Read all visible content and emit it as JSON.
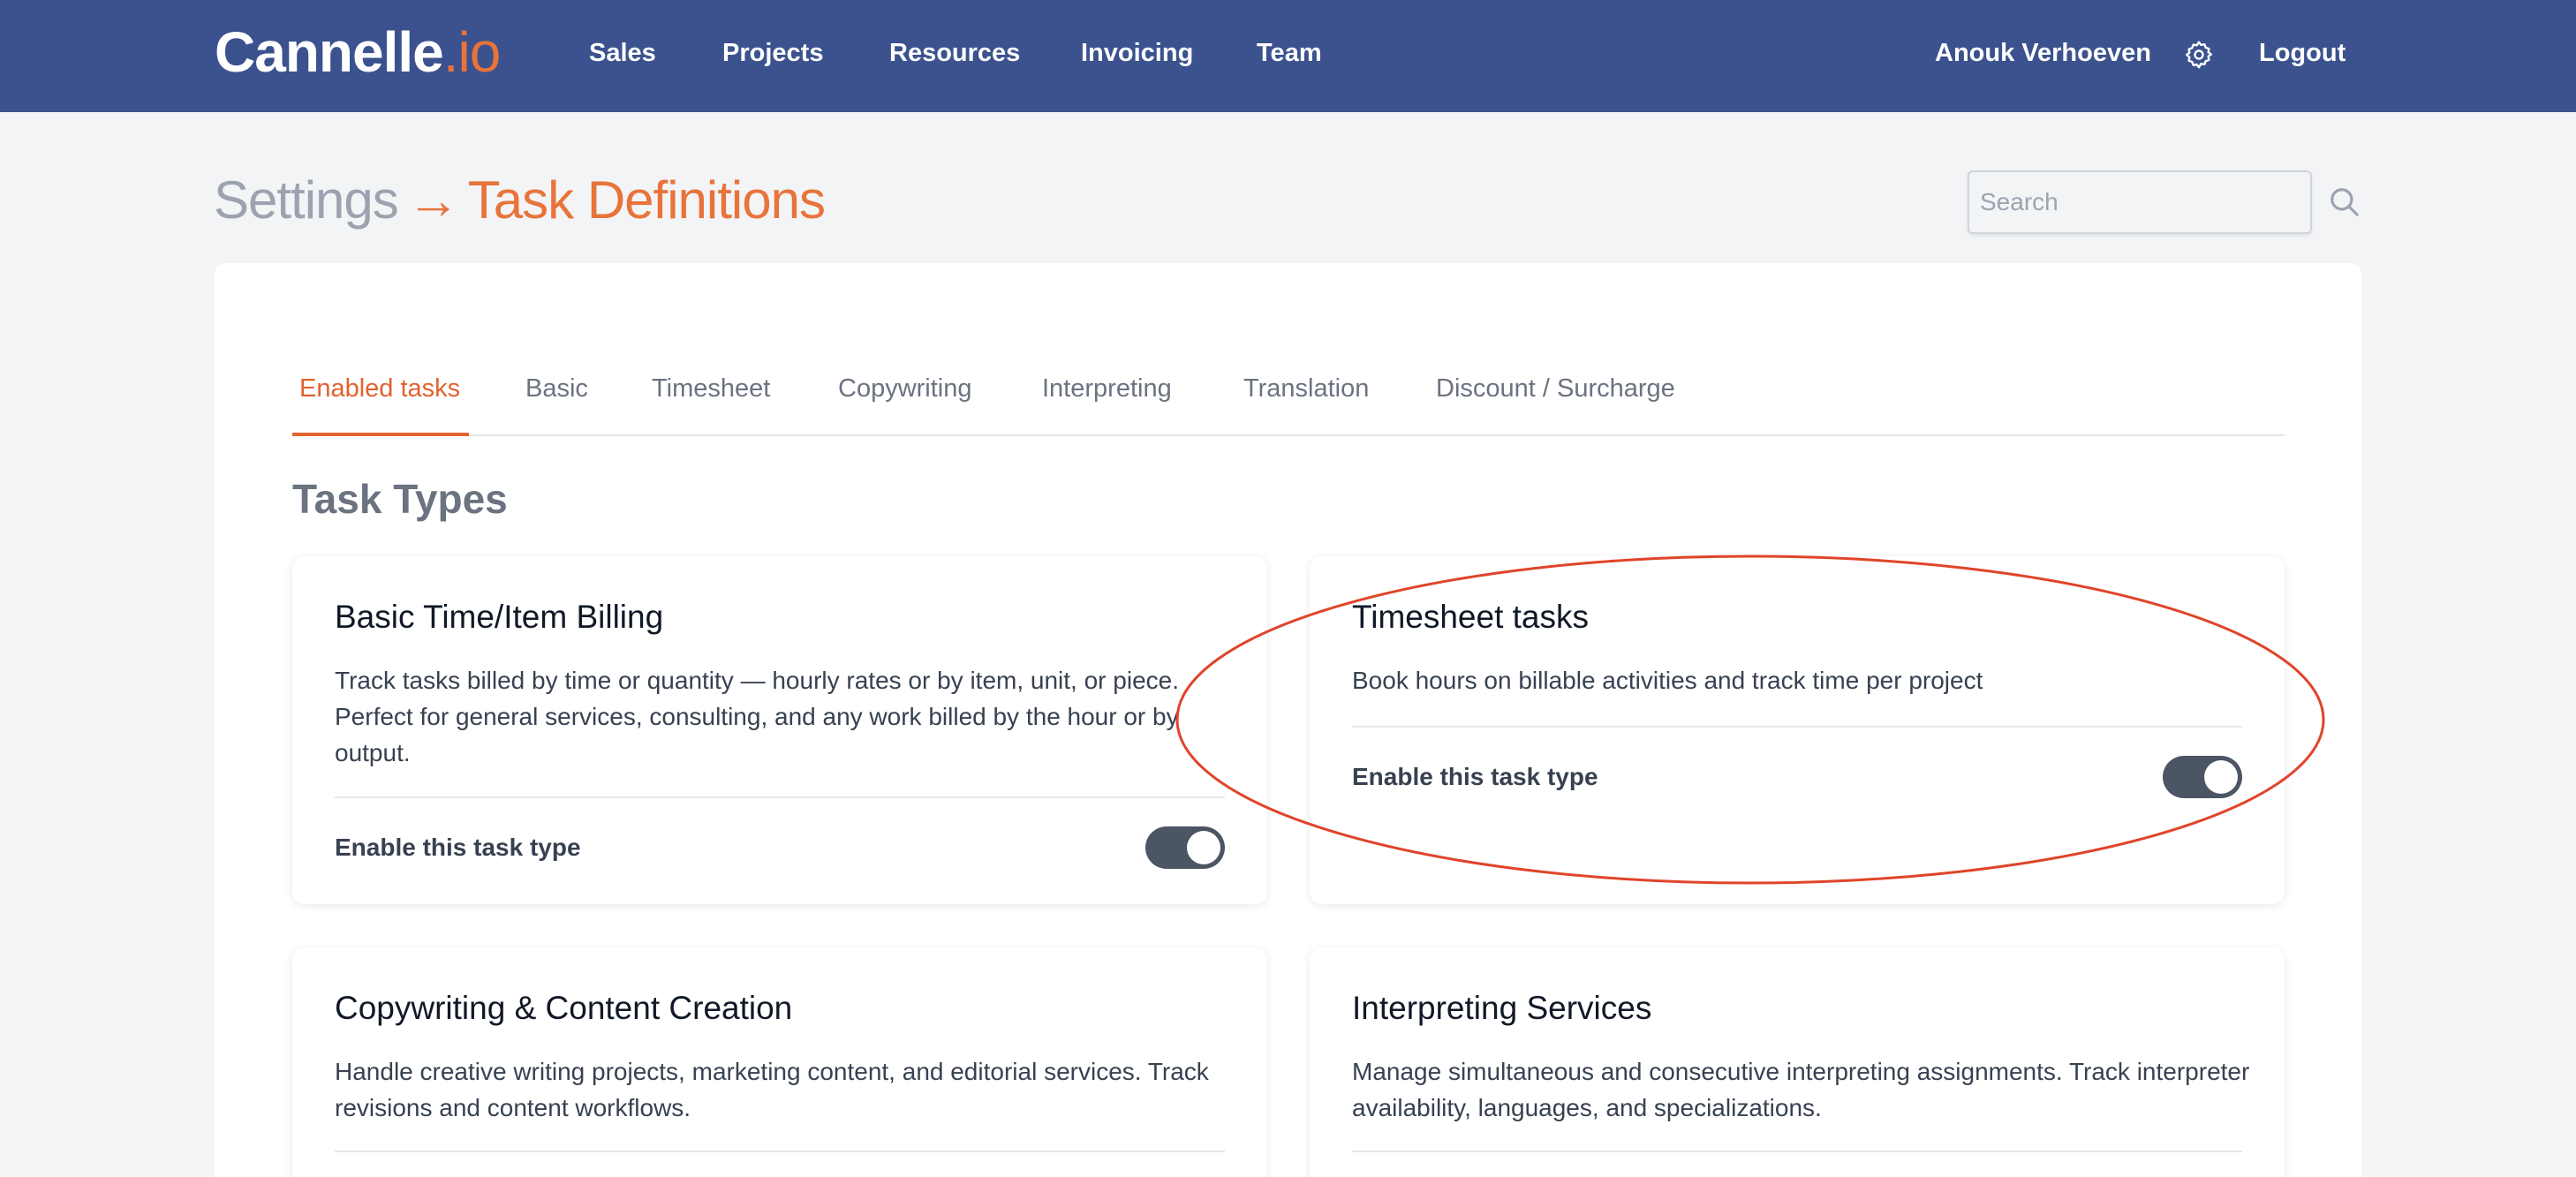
{
  "app": {
    "logo_main": "Cannelle",
    "logo_accent": ".io"
  },
  "nav": {
    "items": [
      "Sales",
      "Projects",
      "Resources",
      "Invoicing",
      "Team"
    ],
    "user_name": "Anouk Verhoeven",
    "settings_icon": "gear-icon",
    "logout_label": "Logout"
  },
  "header": {
    "breadcrumb_parent": "Settings",
    "breadcrumb_separator": "→",
    "breadcrumb_current": "Task Definitions"
  },
  "search": {
    "placeholder": "Search",
    "value": "",
    "icon": "search-icon"
  },
  "tabs": {
    "items": [
      "Enabled tasks",
      "Basic",
      "Timesheet",
      "Copywriting",
      "Interpreting",
      "Translation",
      "Discount / Surcharge"
    ],
    "active": "Enabled tasks"
  },
  "section": {
    "title": "Task Types"
  },
  "task_cards": [
    {
      "title": "Basic Time/Item Billing",
      "description": "Track tasks billed by time or quantity — hourly rates or by item, unit, or piece. Perfect for general services, consulting, and any work billed by the hour or by output.",
      "enable_label": "Enable this task type",
      "enabled": true
    },
    {
      "title": "Timesheet tasks",
      "description": "Book hours on billable activities and track time per project",
      "enable_label": "Enable this task type",
      "enabled": true
    },
    {
      "title": "Copywriting & Content Creation",
      "description": "Handle creative writing projects, marketing content, and editorial services. Track revisions and content workflows."
    },
    {
      "title": "Interpreting Services",
      "description": "Manage simultaneous and consecutive interpreting assignments. Track interpreter availability, languages, and specializations."
    }
  ],
  "colors": {
    "nav_bg": "#3b528e",
    "accent": "#e8743b",
    "active_tab": "#e2622f",
    "toggle_on": "#4b5563",
    "annotation": "#e0442a"
  }
}
